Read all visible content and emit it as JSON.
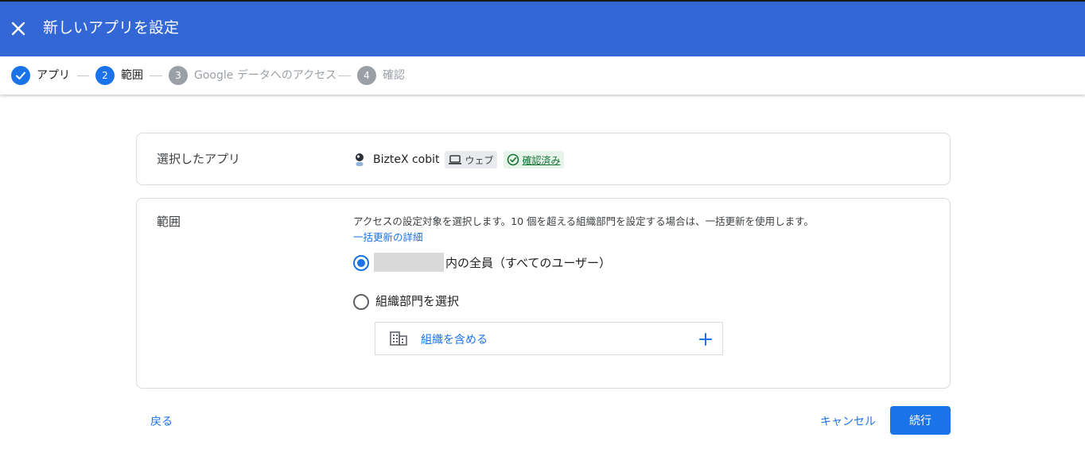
{
  "header": {
    "title": "新しいアプリを設定",
    "background": "#3367d6"
  },
  "stepper": {
    "steps": [
      {
        "number": "",
        "label": "アプリ",
        "state": "done"
      },
      {
        "number": "2",
        "label": "範囲",
        "state": "active"
      },
      {
        "number": "3",
        "label": "Google データへのアクセス",
        "state": "upcoming"
      },
      {
        "number": "4",
        "label": "確認",
        "state": "upcoming"
      }
    ]
  },
  "selected_app": {
    "section_label": "選択したアプリ",
    "app_name": "BizteX cobit",
    "platform_label": "ウェブ",
    "verified_label": "確認済み"
  },
  "scope": {
    "section_label": "範囲",
    "description": "アクセスの設定対象を選択します。10 個を超える組織部門を設定する場合は、一括更新を使用します。",
    "bulk_link": "一括更新の詳細",
    "option_all_suffix": "内の全員（すべてのユーザー）",
    "option_org_units": "組織部門を選択",
    "include_org_label": "組織を含める",
    "selected_option": "all"
  },
  "footer": {
    "back_label": "戻る",
    "cancel_label": "キャンセル",
    "continue_label": "続行"
  },
  "colors": {
    "accent": "#1a73e8",
    "verified_bg": "#e6f4ea",
    "verified_fg": "#137333"
  }
}
